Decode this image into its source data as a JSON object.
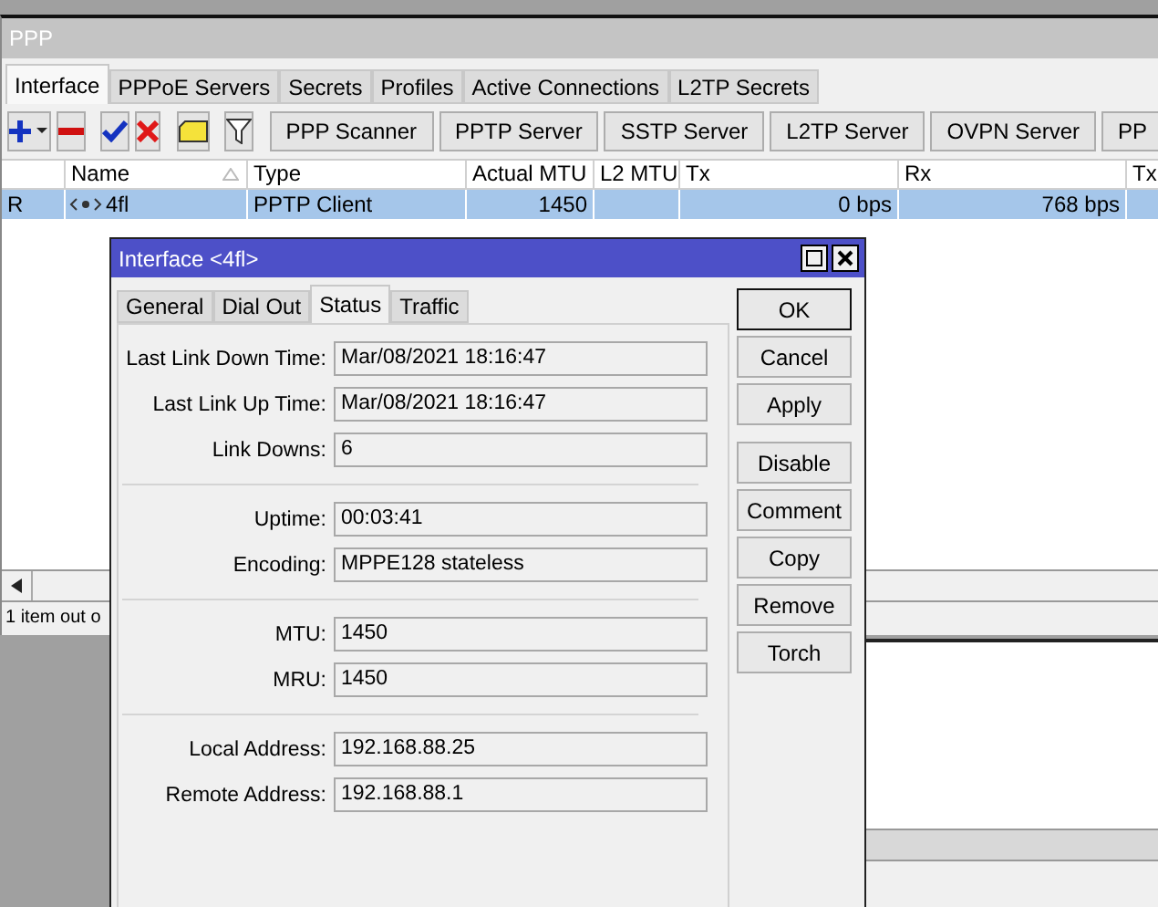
{
  "window": {
    "title": "PPP"
  },
  "tabs": [
    {
      "label": "Interface",
      "selected": true
    },
    {
      "label": "PPPoE Servers",
      "selected": false
    },
    {
      "label": "Secrets",
      "selected": false
    },
    {
      "label": "Profiles",
      "selected": false
    },
    {
      "label": "Active Connections",
      "selected": false
    },
    {
      "label": "L2TP Secrets",
      "selected": false
    }
  ],
  "toolbar_buttons": [
    "PPP Scanner",
    "PPTP Server",
    "SSTP Server",
    "L2TP Server",
    "OVPN Server",
    "PP"
  ],
  "table": {
    "columns": [
      "Name",
      "Type",
      "Actual MTU",
      "L2 MTU",
      "Tx",
      "Rx",
      "Tx"
    ],
    "rows": [
      {
        "flag": "R",
        "name": "4fl",
        "type": "PPTP Client",
        "actual_mtu": "1450",
        "tx": "0 bps",
        "rx": "768 bps",
        "selected": true
      }
    ]
  },
  "status_bar": "1 item out o",
  "dialog": {
    "title": "Interface <4fl>",
    "tabs": [
      {
        "label": "General",
        "selected": false
      },
      {
        "label": "Dial Out",
        "selected": false
      },
      {
        "label": "Status",
        "selected": true
      },
      {
        "label": "Traffic",
        "selected": false
      }
    ],
    "groups": [
      [
        {
          "label": "Last Link Down Time:",
          "value": "Mar/08/2021 18:16:47"
        },
        {
          "label": "Last Link Up Time:",
          "value": "Mar/08/2021 18:16:47"
        },
        {
          "label": "Link Downs:",
          "value": "6"
        }
      ],
      [
        {
          "label": "Uptime:",
          "value": "00:03:41"
        },
        {
          "label": "Encoding:",
          "value": "MPPE128 stateless"
        }
      ],
      [
        {
          "label": "MTU:",
          "value": "1450"
        },
        {
          "label": "MRU:",
          "value": "1450"
        }
      ],
      [
        {
          "label": "Local Address:",
          "value": "192.168.88.25"
        },
        {
          "label": "Remote Address:",
          "value": "192.168.88.1"
        }
      ]
    ],
    "button_groups": [
      [
        {
          "label": "OK",
          "default": true
        },
        {
          "label": "Cancel",
          "default": false
        },
        {
          "label": "Apply",
          "default": false
        }
      ],
      [
        {
          "label": "Disable",
          "default": false
        },
        {
          "label": "Comment",
          "default": false
        },
        {
          "label": "Copy",
          "default": false
        },
        {
          "label": "Remove",
          "default": false
        },
        {
          "label": "Torch",
          "default": false
        }
      ]
    ]
  }
}
